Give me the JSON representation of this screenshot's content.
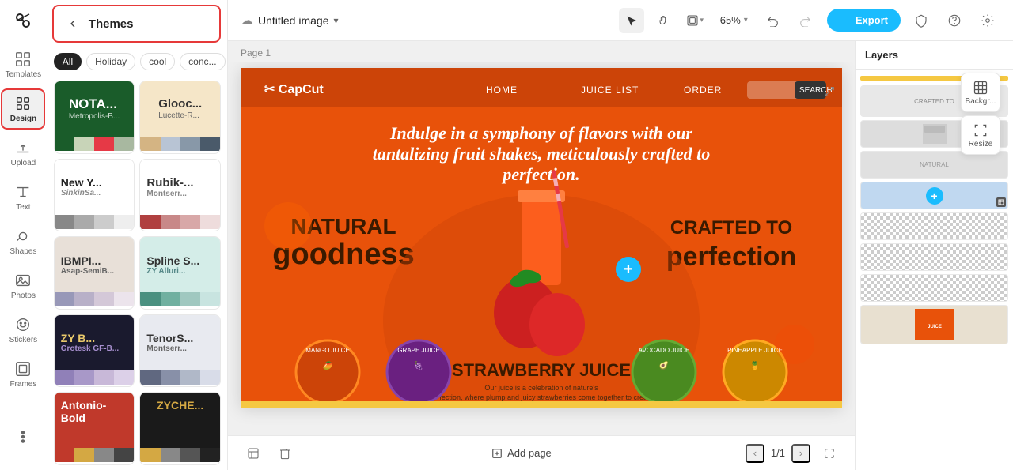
{
  "app": {
    "logo": "✂",
    "title": "Untitled image",
    "title_chevron": "▾"
  },
  "sidebar": {
    "items": [
      {
        "id": "templates",
        "label": "Templates",
        "icon": "grid"
      },
      {
        "id": "design",
        "label": "Design",
        "icon": "diamond",
        "active": true
      },
      {
        "id": "upload",
        "label": "Upload",
        "icon": "upload"
      },
      {
        "id": "text",
        "label": "Text",
        "icon": "T"
      },
      {
        "id": "shapes",
        "label": "Shapes",
        "icon": "shapes"
      },
      {
        "id": "photos",
        "label": "Photos",
        "icon": "photos"
      },
      {
        "id": "stickers",
        "label": "Stickers",
        "icon": "stickers"
      },
      {
        "id": "frames",
        "label": "Frames",
        "icon": "frames"
      }
    ]
  },
  "themes": {
    "header": "Themes",
    "back_label": "‹",
    "filters": [
      {
        "id": "all",
        "label": "All",
        "active": true
      },
      {
        "id": "holiday",
        "label": "Holiday",
        "active": false
      },
      {
        "id": "cool",
        "label": "cool",
        "active": false
      },
      {
        "id": "concept",
        "label": "conc...",
        "active": false
      }
    ],
    "cards": [
      {
        "id": "nota",
        "top_text": "NOTA...",
        "sub_text": "Metropolis-B...",
        "colors": [
          "#1a5c2a",
          "#c8d4b8",
          "#e63946",
          "#a8b8a0"
        ],
        "bg": "#1a5c2a",
        "text_color": "#fff"
      },
      {
        "id": "glooc",
        "top_text": "Glooc...",
        "sub_text": "Lucette-R...",
        "colors": [
          "#d4b483",
          "#b8c4d4",
          "#8898a8",
          "#4a5a6a"
        ],
        "bg": "#f5e6c8",
        "text_color": "#333"
      },
      {
        "id": "newy",
        "top_text": "New Y...",
        "sub_text": "SinkinSa...",
        "colors": [
          "#888",
          "#aaa",
          "#ccc",
          "#eee"
        ],
        "bg": "#fff",
        "text_color": "#222"
      },
      {
        "id": "rubik",
        "top_text": "Rubik-...",
        "sub_text": "Montserr...",
        "colors": [
          "#b04040",
          "#c88888",
          "#d8a8a8",
          "#eedcdc"
        ],
        "bg": "#fff",
        "text_color": "#333"
      },
      {
        "id": "ibmpl",
        "top_text": "IBMPI...",
        "sub_text": "Asap-SemiB...",
        "colors": [
          "#9898b8",
          "#b8b0c8",
          "#d4c8d8",
          "#ece4ec"
        ],
        "bg": "#e8e0d8",
        "text_color": "#444"
      },
      {
        "id": "spline",
        "top_text": "Spline S...",
        "sub_text": "ZY Alluri...",
        "colors": [
          "#4a9080",
          "#70b0a0",
          "#a0c8c0",
          "#c8e4e0"
        ],
        "bg": "#d4ede8",
        "text_color": "#333"
      },
      {
        "id": "zy",
        "top_text": "ZY B...",
        "sub_text": "Grotesk GF-B...",
        "colors": [
          "#9080b8",
          "#a898c8",
          "#c8b8d8",
          "#dcd0e8"
        ],
        "bg": "#1a1a2e",
        "text_color": "#e8c86a"
      },
      {
        "id": "tenor",
        "top_text": "TenorS...",
        "sub_text": "Montserr...",
        "colors": [
          "#606880",
          "#8890a8",
          "#b0b8c8",
          "#d8dce8"
        ],
        "bg": "#e8eaf0",
        "text_color": "#333"
      },
      {
        "id": "antonio",
        "top_text": "Antonio-Bold",
        "sub_text": "",
        "colors": [
          "#c0392b",
          "#d4a843",
          "#888",
          "#444"
        ],
        "bg": "#c0392b",
        "text_color": "#fff"
      },
      {
        "id": "zyche",
        "top_text": "ZYCHE...",
        "sub_text": "",
        "colors": [
          "#d4a843",
          "#888",
          "#555",
          "#222"
        ],
        "bg": "#1a1a1a",
        "text_color": "#d4a843"
      }
    ]
  },
  "topbar": {
    "cloud_icon": "☁",
    "title": "Untitled image",
    "zoom": "65%",
    "export_label": "Export",
    "export_icon": "↑"
  },
  "canvas": {
    "page_label": "Page 1",
    "float_tools": [
      {
        "id": "background",
        "label": "Backgr..."
      },
      {
        "id": "resize",
        "label": "Resize"
      }
    ]
  },
  "layers": {
    "title": "Layers"
  },
  "bottom_bar": {
    "add_page": "Add page",
    "page_current": "1",
    "page_total": "1",
    "page_display": "1/1"
  }
}
